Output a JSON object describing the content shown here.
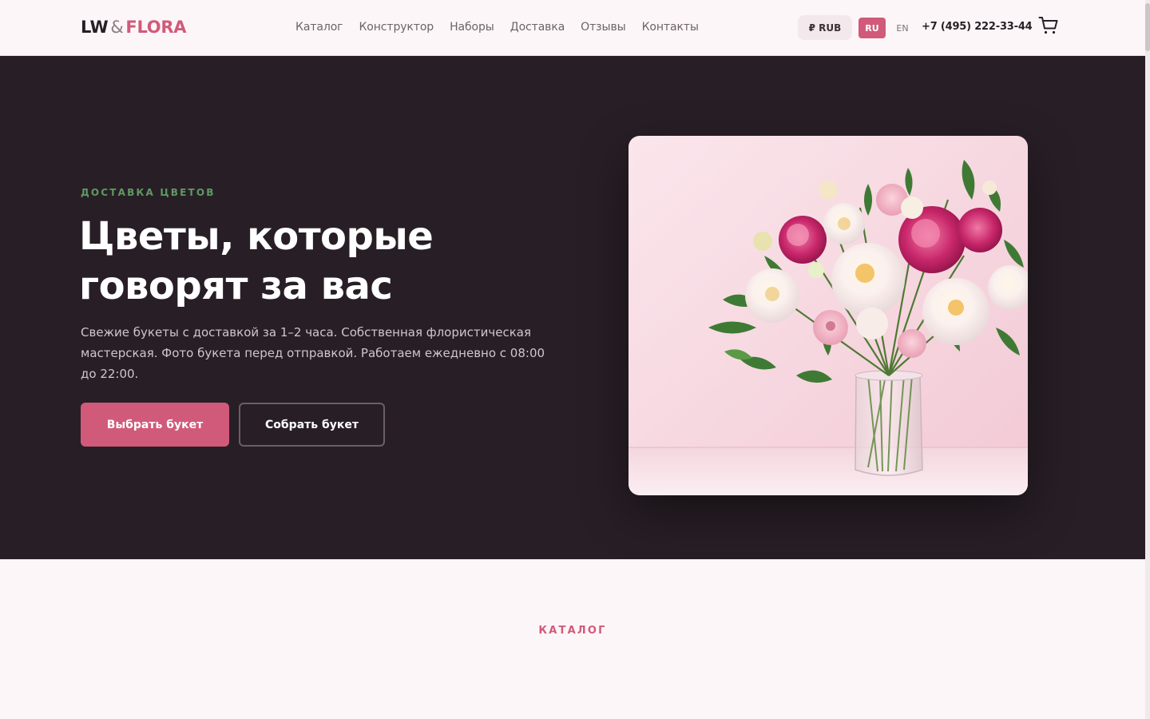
{
  "header": {
    "logo": {
      "lw": "LW",
      "amp": "&",
      "flora": "FLORA"
    },
    "nav": [
      "Каталог",
      "Конструктор",
      "Наборы",
      "Доставка",
      "Отзывы",
      "Контакты"
    ],
    "currency": "₽ RUB",
    "languages": {
      "ru": "RU",
      "en": "EN",
      "active": "RU"
    },
    "phone": "+7 (495) 222-33-44",
    "cart_icon": "cart-icon"
  },
  "hero": {
    "eyebrow": "ДОСТАВКА ЦВЕТОВ",
    "title": "Цветы, которые говорят за вас",
    "description": "Свежие букеты с доставкой за 1–2 часа. Собственная флористическая мастерская. Фото букета перед отправкой. Работаем ежедневно с 08:00 до 22:00.",
    "primary_button": "Выбрать букет",
    "secondary_button": "Собрать букет",
    "image": "bouquet-photo"
  },
  "catalog": {
    "label": "КАТАЛОГ"
  },
  "colors": {
    "accent": "#d15a7a",
    "dark": "#281f26",
    "eyebrow_green": "#5f9a62",
    "background": "#fdf6f8"
  }
}
